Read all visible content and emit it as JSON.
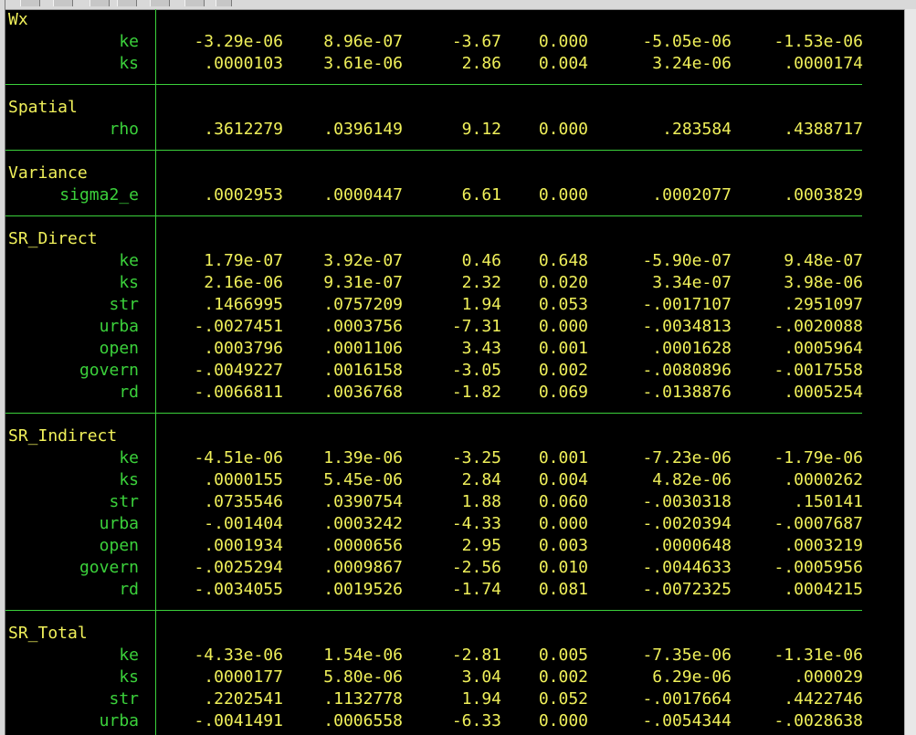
{
  "panels": [
    {
      "label": "Wx",
      "rows": [
        {
          "var": "ke",
          "vals": [
            "-3.29e-06",
            "8.96e-07",
            "-3.67",
            "0.000",
            "-5.05e-06",
            "-1.53e-06"
          ]
        },
        {
          "var": "ks",
          "vals": [
            ".0000103",
            "3.61e-06",
            "2.86",
            "0.004",
            "3.24e-06",
            ".0000174"
          ]
        }
      ]
    },
    {
      "label": "Spatial",
      "rows": [
        {
          "var": "rho",
          "vals": [
            ".3612279",
            ".0396149",
            "9.12",
            "0.000",
            ".283584",
            ".4388717"
          ]
        }
      ]
    },
    {
      "label": "Variance",
      "rows": [
        {
          "var": "sigma2_e",
          "vals": [
            ".0002953",
            ".0000447",
            "6.61",
            "0.000",
            ".0002077",
            ".0003829"
          ]
        }
      ]
    },
    {
      "label": "SR_Direct",
      "rows": [
        {
          "var": "ke",
          "vals": [
            "1.79e-07",
            "3.92e-07",
            "0.46",
            "0.648",
            "-5.90e-07",
            "9.48e-07"
          ]
        },
        {
          "var": "ks",
          "vals": [
            "2.16e-06",
            "9.31e-07",
            "2.32",
            "0.020",
            "3.34e-07",
            "3.98e-06"
          ]
        },
        {
          "var": "str",
          "vals": [
            ".1466995",
            ".0757209",
            "1.94",
            "0.053",
            "-.0017107",
            ".2951097"
          ]
        },
        {
          "var": "urba",
          "vals": [
            "-.0027451",
            ".0003756",
            "-7.31",
            "0.000",
            "-.0034813",
            "-.0020088"
          ]
        },
        {
          "var": "open",
          "vals": [
            ".0003796",
            ".0001106",
            "3.43",
            "0.001",
            ".0001628",
            ".0005964"
          ]
        },
        {
          "var": "govern",
          "vals": [
            "-.0049227",
            ".0016158",
            "-3.05",
            "0.002",
            "-.0080896",
            "-.0017558"
          ]
        },
        {
          "var": "rd",
          "vals": [
            "-.0066811",
            ".0036768",
            "-1.82",
            "0.069",
            "-.0138876",
            ".0005254"
          ]
        }
      ]
    },
    {
      "label": "SR_Indirect",
      "rows": [
        {
          "var": "ke",
          "vals": [
            "-4.51e-06",
            "1.39e-06",
            "-3.25",
            "0.001",
            "-7.23e-06",
            "-1.79e-06"
          ]
        },
        {
          "var": "ks",
          "vals": [
            ".0000155",
            "5.45e-06",
            "2.84",
            "0.004",
            "4.82e-06",
            ".0000262"
          ]
        },
        {
          "var": "str",
          "vals": [
            ".0735546",
            ".0390754",
            "1.88",
            "0.060",
            "-.0030318",
            ".150141"
          ]
        },
        {
          "var": "urba",
          "vals": [
            "-.001404",
            ".0003242",
            "-4.33",
            "0.000",
            "-.0020394",
            "-.0007687"
          ]
        },
        {
          "var": "open",
          "vals": [
            ".0001934",
            ".0000656",
            "2.95",
            "0.003",
            ".0000648",
            ".0003219"
          ]
        },
        {
          "var": "govern",
          "vals": [
            "-.0025294",
            ".0009867",
            "-2.56",
            "0.010",
            "-.0044633",
            "-.0005956"
          ]
        },
        {
          "var": "rd",
          "vals": [
            "-.0034055",
            ".0019526",
            "-1.74",
            "0.081",
            "-.0072325",
            ".0004215"
          ]
        }
      ]
    },
    {
      "label": "SR_Total",
      "rows": [
        {
          "var": "ke",
          "vals": [
            "-4.33e-06",
            "1.54e-06",
            "-2.81",
            "0.005",
            "-7.35e-06",
            "-1.31e-06"
          ]
        },
        {
          "var": "ks",
          "vals": [
            ".0000177",
            "5.80e-06",
            "3.04",
            "0.002",
            "6.29e-06",
            ".000029"
          ]
        },
        {
          "var": "str",
          "vals": [
            ".2202541",
            ".1132778",
            "1.94",
            "0.052",
            "-.0017664",
            ".4422746"
          ]
        },
        {
          "var": "urba",
          "vals": [
            "-.0041491",
            ".0006558",
            "-6.33",
            "0.000",
            "-.0054344",
            "-.0028638"
          ]
        }
      ]
    }
  ],
  "colors": {
    "background": "#000000",
    "values": "#f0f05a",
    "labels": "#3bd13b",
    "rules": "#3bd13b"
  }
}
